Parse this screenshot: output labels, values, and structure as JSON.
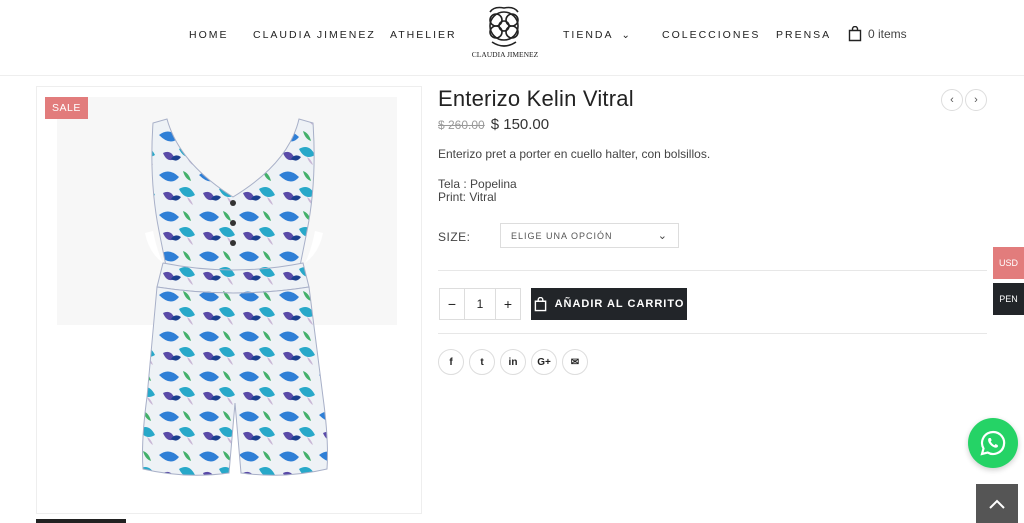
{
  "nav": {
    "home": "HOME",
    "claudia": "CLAUDIA JIMENEZ",
    "athelier": "ATHELIER",
    "tienda": "TIENDA",
    "colecciones": "COLECCIONES",
    "prensa": "PRENSA"
  },
  "logo": {
    "text": "CLAUDIA JIMENEZ"
  },
  "cart": {
    "label": "0 items"
  },
  "product": {
    "sale_badge": "SALE",
    "title": "Enterizo Kelin Vitral",
    "old_price": "$ 260.00",
    "new_price": "$ 150.00",
    "description": "Enterizo pret a porter en cuello halter, con bolsillos.",
    "spec_fabric": "Tela : Popelina",
    "spec_print": "Print: Vitral",
    "size_label": "SIZE:",
    "size_placeholder": "ELIGE UNA OPCIÓN",
    "quantity": "1",
    "qty_minus": "−",
    "qty_plus": "+",
    "add_to_cart": "AÑADIR AL CARRITO"
  },
  "share": {
    "facebook": "f",
    "twitter": "t",
    "linkedin": "in",
    "googleplus": "G+",
    "email": "✉"
  },
  "currency": {
    "usd": "USD",
    "pen": "PEN"
  },
  "colors": {
    "sale": "#e27c7c",
    "usd_bg": "#e27c7c",
    "pen_bg": "#222529",
    "whatsapp": "#25d366",
    "button": "#222529"
  }
}
